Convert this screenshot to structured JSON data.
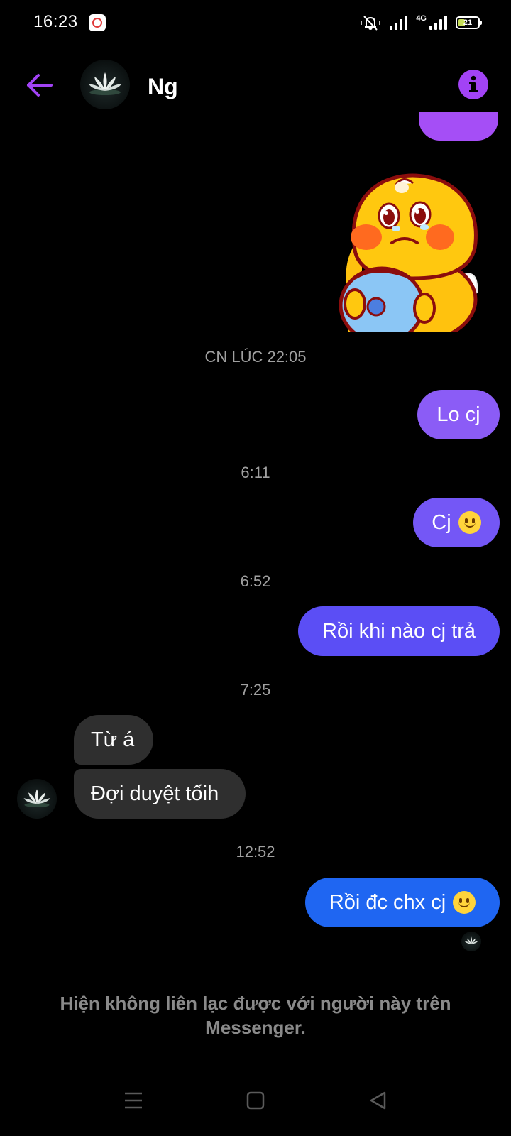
{
  "status_bar": {
    "time": "16:23",
    "network": "4G",
    "battery": "21",
    "battery_level": 0.21
  },
  "header": {
    "contact_name": "Ng",
    "back_icon": "arrow-left-icon",
    "info_icon": "info-icon"
  },
  "colors": {
    "accent": "#a243f5",
    "bubble_out_purple": "#8b5cf6",
    "bubble_out_indigo": "#5b4ef5",
    "bubble_out_blue": "#1f66f2",
    "bubble_in": "#2f2f2f",
    "background": "#000000"
  },
  "messages": {
    "ts1": "CN LÚC 22:05",
    "m1": "Lo cj",
    "ts2": "6:11",
    "m2": "Cj",
    "ts3": "6:52",
    "m3": "Rồi khi nào cj trả",
    "ts4": "7:25",
    "m4": "Từ á",
    "m5": "Đợi duyệt tốih",
    "ts5": "12:52",
    "m6": "Rồi đc chx cj"
  },
  "notice": {
    "line1": "Hiện không liên lạc được với người này trên",
    "line2": "Messenger."
  },
  "navigation": {
    "menu_icon": "menu-icon",
    "home_icon": "home-square-icon",
    "back_icon": "back-triangle-icon"
  }
}
